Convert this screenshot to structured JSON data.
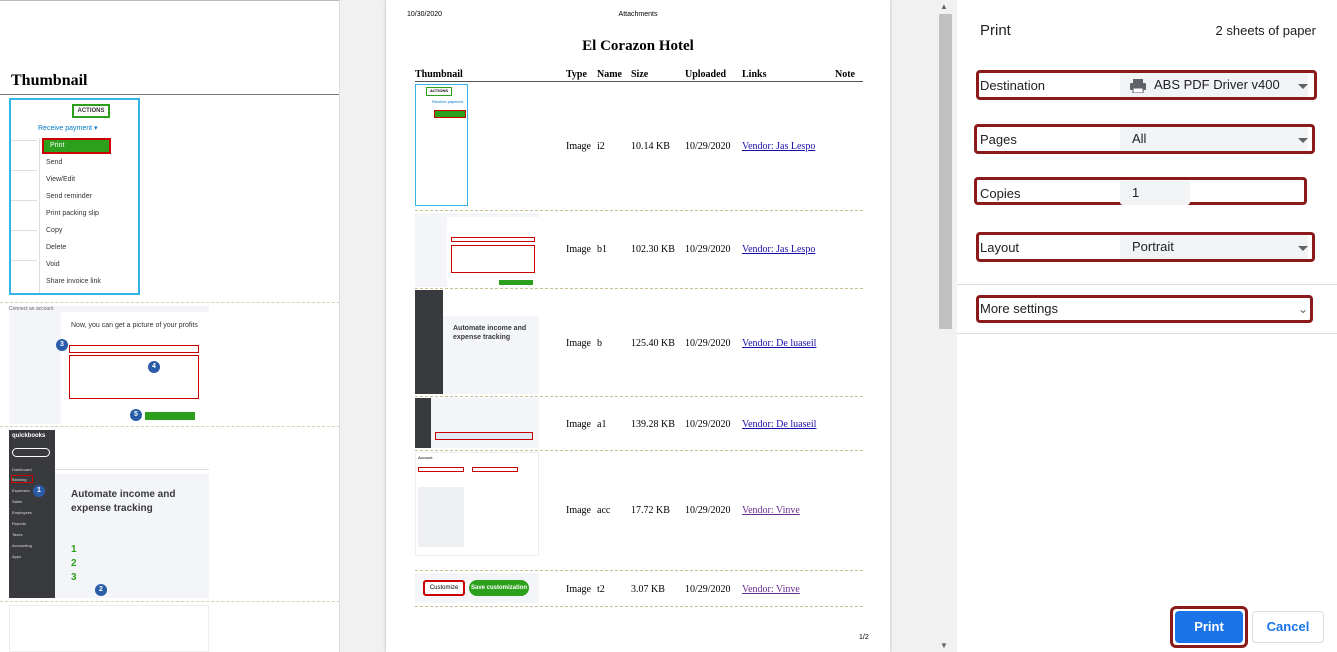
{
  "left_page": {
    "heading": "Thumbnail",
    "actions_thumb": {
      "actions_label": "ACTIONS",
      "dropdown_label": "Receive payment",
      "menu_items": [
        "Print",
        "Send",
        "View/Edit",
        "Send reminder",
        "Print packing slip",
        "Copy",
        "Delete",
        "Void",
        "Share invoice link"
      ]
    },
    "profits_thumb": {
      "header": "Connect an account",
      "heading": "Now, you can get a picture of your profits",
      "badges": [
        "3",
        "4",
        "5"
      ]
    },
    "qb_thumb": {
      "logo": "quickbooks",
      "new_label": "+ New",
      "nav_items": [
        "Dashboard",
        "Banking",
        "Expenses",
        "Sales",
        "Employees",
        "Reports",
        "Taxes",
        "Accounting",
        "Apps"
      ],
      "heading": "Automate income and expense tracking",
      "steps": [
        "1",
        "2",
        "3"
      ],
      "badges": [
        "1",
        "2"
      ]
    }
  },
  "preview": {
    "date": "10/30/2020",
    "doc_title": "Attachments",
    "hotel_name": "El Corazon Hotel",
    "page_number": "1/2",
    "columns": [
      "Thumbnail",
      "Type",
      "Name",
      "Size",
      "Uploaded",
      "Links",
      "Note"
    ],
    "rows": [
      {
        "type": "Image",
        "name": "i2",
        "size": "10.14 KB",
        "uploaded": "10/29/2020",
        "link": "Vendor: Jas Lespo",
        "note": ""
      },
      {
        "type": "Image",
        "name": "b1",
        "size": "102.30 KB",
        "uploaded": "10/29/2020",
        "link": "Vendor: Jas Lespo",
        "note": ""
      },
      {
        "type": "Image",
        "name": "b",
        "size": "125.40 KB",
        "uploaded": "10/29/2020",
        "link": "Vendor: De luaseil",
        "note": ""
      },
      {
        "type": "Image",
        "name": "a1",
        "size": "139.28 KB",
        "uploaded": "10/29/2020",
        "link": "Vendor: De luaseil",
        "note": ""
      },
      {
        "type": "Image",
        "name": "acc",
        "size": "17.72 KB",
        "uploaded": "10/29/2020",
        "link": "Vendor: Vinve",
        "note": ""
      },
      {
        "type": "Image",
        "name": "t2",
        "size": "3.07 KB",
        "uploaded": "10/29/2020",
        "link": "Vendor: Vinve",
        "note": ""
      }
    ],
    "thumb_texts": {
      "actions": "ACTIONS",
      "receive": "Receive payment",
      "automate": "Automate income and expense tracking",
      "customize": "Customize",
      "save_customization": "Save customization",
      "account": "Account"
    }
  },
  "print_panel": {
    "title": "Print",
    "sheets": "2 sheets of paper",
    "destination": {
      "label": "Destination",
      "value": "ABS PDF Driver v400"
    },
    "pages": {
      "label": "Pages",
      "value": "All"
    },
    "copies": {
      "label": "Copies",
      "value": "1"
    },
    "layout": {
      "label": "Layout",
      "value": "Portrait"
    },
    "more_settings": "More settings",
    "print_button": "Print",
    "cancel_button": "Cancel"
  },
  "colors": {
    "accent": "#1a73e8",
    "highlight": "#8b1a1a",
    "qb_green": "#2ca01c",
    "link_blue": "#1a0dab",
    "link_visited": "#6b2f8f"
  },
  "icons": [
    "printer-icon",
    "caret-down-icon",
    "chevron-down-icon",
    "scroll-up-icon",
    "scroll-down-icon"
  ]
}
